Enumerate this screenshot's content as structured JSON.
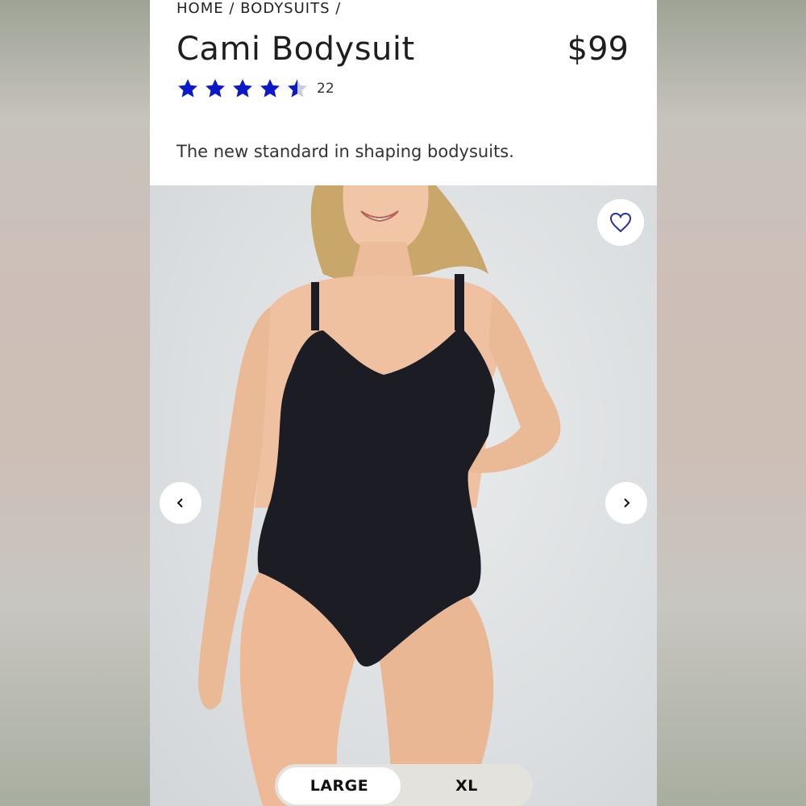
{
  "breadcrumb": "HOME / BODYSUITS /",
  "product": {
    "title": "Cami Bodysuit",
    "price": "$99",
    "rating": 4.5,
    "rating_max": 5,
    "review_count": "22",
    "tagline": "The new standard in shaping bodysuits."
  },
  "colors": {
    "star_filled": "#0a1acb",
    "star_empty": "#c9cdd6",
    "heart": "#2a2f9e",
    "bodysuit": "#1c1c24"
  },
  "icons": {
    "wishlist": "heart-icon",
    "prev": "chevron-left-icon",
    "next": "chevron-right-icon"
  },
  "sizes": {
    "options": [
      "LARGE",
      "XL"
    ],
    "selected": "LARGE"
  }
}
